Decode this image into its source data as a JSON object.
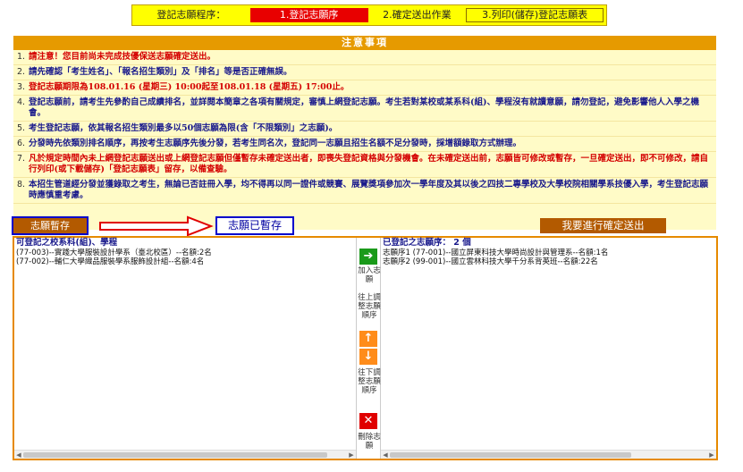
{
  "steps": {
    "label": "登記志願程序：",
    "items": [
      "1.登記志願序",
      "2.確定送出作業",
      "3.列印(儲存)登記志願表"
    ]
  },
  "notice": {
    "title": "注意事項",
    "items": [
      {
        "num": "1.",
        "text": "請注意！您目前尚未完成技優保送志願確定送出。",
        "color": "red"
      },
      {
        "num": "2.",
        "text": "請先確認「考生姓名」、「報名招生類別」及「排名」等是否正確無誤。",
        "color": "blue"
      },
      {
        "num": "3.",
        "text": "登記志願期限為108.01.16 (星期三) 10:00起至108.01.18 (星期五) 17:00止。",
        "color": "red"
      },
      {
        "num": "4.",
        "text": "登記志願前，請考生先參酌自己成績排名，並詳閱本簡章之各項有關規定，審慎上網登記志願。考生若對某校或某系科(組)、學程沒有就讀意願，請勿登記，避免影響他人入學之機會。",
        "color": "blue"
      },
      {
        "num": "5.",
        "text": "考生登記志願，依其報名招生類別最多以50個志願為限(含「不限類別」之志願)。",
        "color": "blue"
      },
      {
        "num": "6.",
        "text": "分發時先依類別排名順序，再按考生志願序先後分發，若考生同名次，登記同一志願且招生名額不足分發時，採增額錄取方式辦理。",
        "color": "blue"
      },
      {
        "num": "7.",
        "text": "凡於規定時間內未上網登記志願送出或上網登記志願但僅暫存未確定送出者，即喪失登記資格與分發機會。在未確定送出前，志願皆可修改或暫存，一旦確定送出，即不可修改，請自行列印(或下載儲存)「登記志願表」留存，以備查驗。",
        "color": "red"
      },
      {
        "num": "8.",
        "text": "本招生管道經分發並獲錄取之考生，無論已否註冊入學，均不得再以同一證件或競賽、展覽獎項參加次一學年度及其以後之四技二專學校及大學校院相關學系技優入學，考生登記志願時應慎重考慮。",
        "color": "blue"
      }
    ]
  },
  "actions": {
    "save_label": "志願暫存",
    "saved_status": "志願已暫存",
    "confirm_label": "我要進行確定送出"
  },
  "available": {
    "title": "可登記之校系科(組)、學程",
    "items": [
      "(77-003)--實踐大學服裝設計學系（臺北校區）--名額:2名",
      "(77-002)--輔仁大學織品服裝學系服飾設計組--名額:4名"
    ]
  },
  "registered": {
    "title": "已登記之志願序： 2 個",
    "items": [
      "志願序1 (77-001)--國立屏東科技大學時尚設計與管理系--名額:1名",
      "志願序2 (99-001)--國立雲林科技大學千分系背英班--名額:22名"
    ]
  },
  "mid": {
    "add_label": "加入志願",
    "up_label": "往上調整志願順序",
    "down_label": "往下調整志願順序",
    "delete_label": "刪除志願"
  },
  "colors": {
    "active_step": "#e80000",
    "notice_header": "#e69a00",
    "button_brown": "#b35a00",
    "frame_orange": "#e68a00"
  }
}
